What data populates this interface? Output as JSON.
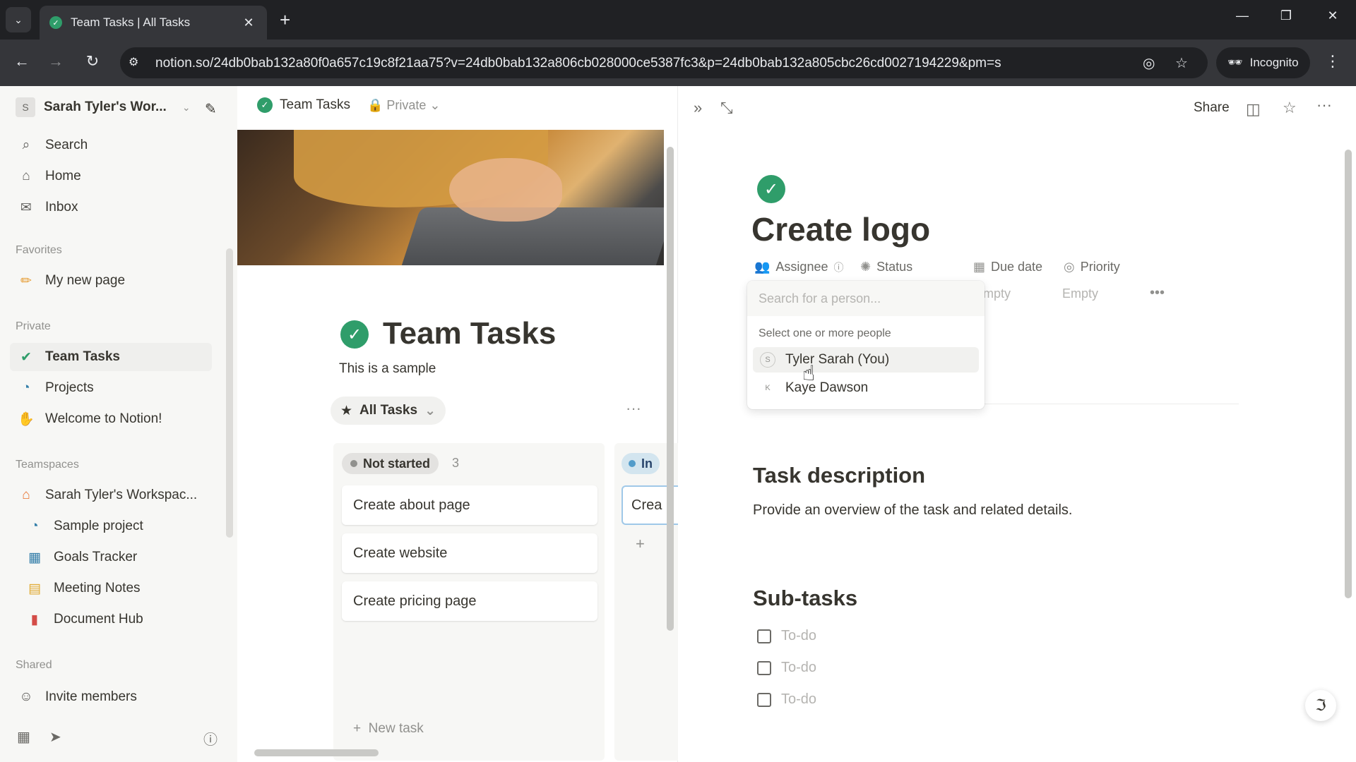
{
  "browser": {
    "tab_title": "Team Tasks | All Tasks",
    "url": "notion.so/24db0bab132a80f0a657c19c8f21aa75?v=24db0bab132a806cb028000ce5387fc3&p=24db0bab132a805cbc26cd0027194229&pm=s",
    "incognito_label": "Incognito"
  },
  "sidebar": {
    "workspace_initial": "S",
    "workspace_name": "Sarah Tyler's Wor...",
    "top_items": [
      {
        "label": "Search",
        "icon": "search-icon"
      },
      {
        "label": "Home",
        "icon": "home-icon"
      },
      {
        "label": "Inbox",
        "icon": "inbox-icon"
      }
    ],
    "favorites_label": "Favorites",
    "favorites": [
      {
        "label": "My new page",
        "icon": "pencil-icon"
      }
    ],
    "private_label": "Private",
    "private_items": [
      {
        "label": "Team Tasks",
        "icon": "check-circle-icon"
      },
      {
        "label": "Projects",
        "icon": "projects-icon"
      },
      {
        "label": "Welcome to Notion!",
        "icon": "wave-icon"
      }
    ],
    "teamspaces_label": "Teamspaces",
    "teamspaces": [
      {
        "label": "Sarah Tyler's Workspac...",
        "icon": "house-icon"
      },
      {
        "label": "Sample project",
        "icon": "projects-icon"
      },
      {
        "label": "Goals Tracker",
        "icon": "goals-icon"
      },
      {
        "label": "Meeting Notes",
        "icon": "calendar-icon"
      },
      {
        "label": "Document Hub",
        "icon": "document-icon"
      }
    ],
    "shared_label": "Shared",
    "invite_label": "Invite members"
  },
  "middle": {
    "breadcrumb_title": "Team Tasks",
    "privacy": "Private",
    "page_title": "Team Tasks",
    "description": "This is a sample",
    "view_tab": "All Tasks",
    "group1": {
      "label": "Not started",
      "count": "3",
      "cards": [
        "Create about page",
        "Create website",
        "Create pricing page"
      ],
      "new_task": "New task"
    },
    "group2": {
      "label": "In",
      "card": "Crea"
    }
  },
  "peek": {
    "share_label": "Share",
    "title": "Create logo",
    "properties": {
      "assignee": "Assignee",
      "status": "Status",
      "due_date": "Due date",
      "priority": "Priority"
    },
    "due_value": "mpty",
    "priority_value": "Empty",
    "section1_title": "Task description",
    "section1_text": "Provide an overview of the task and related details.",
    "section2_title": "Sub-tasks",
    "todos": [
      "To-do",
      "To-do",
      "To-do"
    ]
  },
  "picker": {
    "placeholder": "Search for a person...",
    "label": "Select one or more people",
    "people": [
      {
        "name": "Tyler Sarah (You)",
        "initial": "S"
      },
      {
        "name": "Kaye Dawson",
        "initial": "K"
      }
    ]
  }
}
